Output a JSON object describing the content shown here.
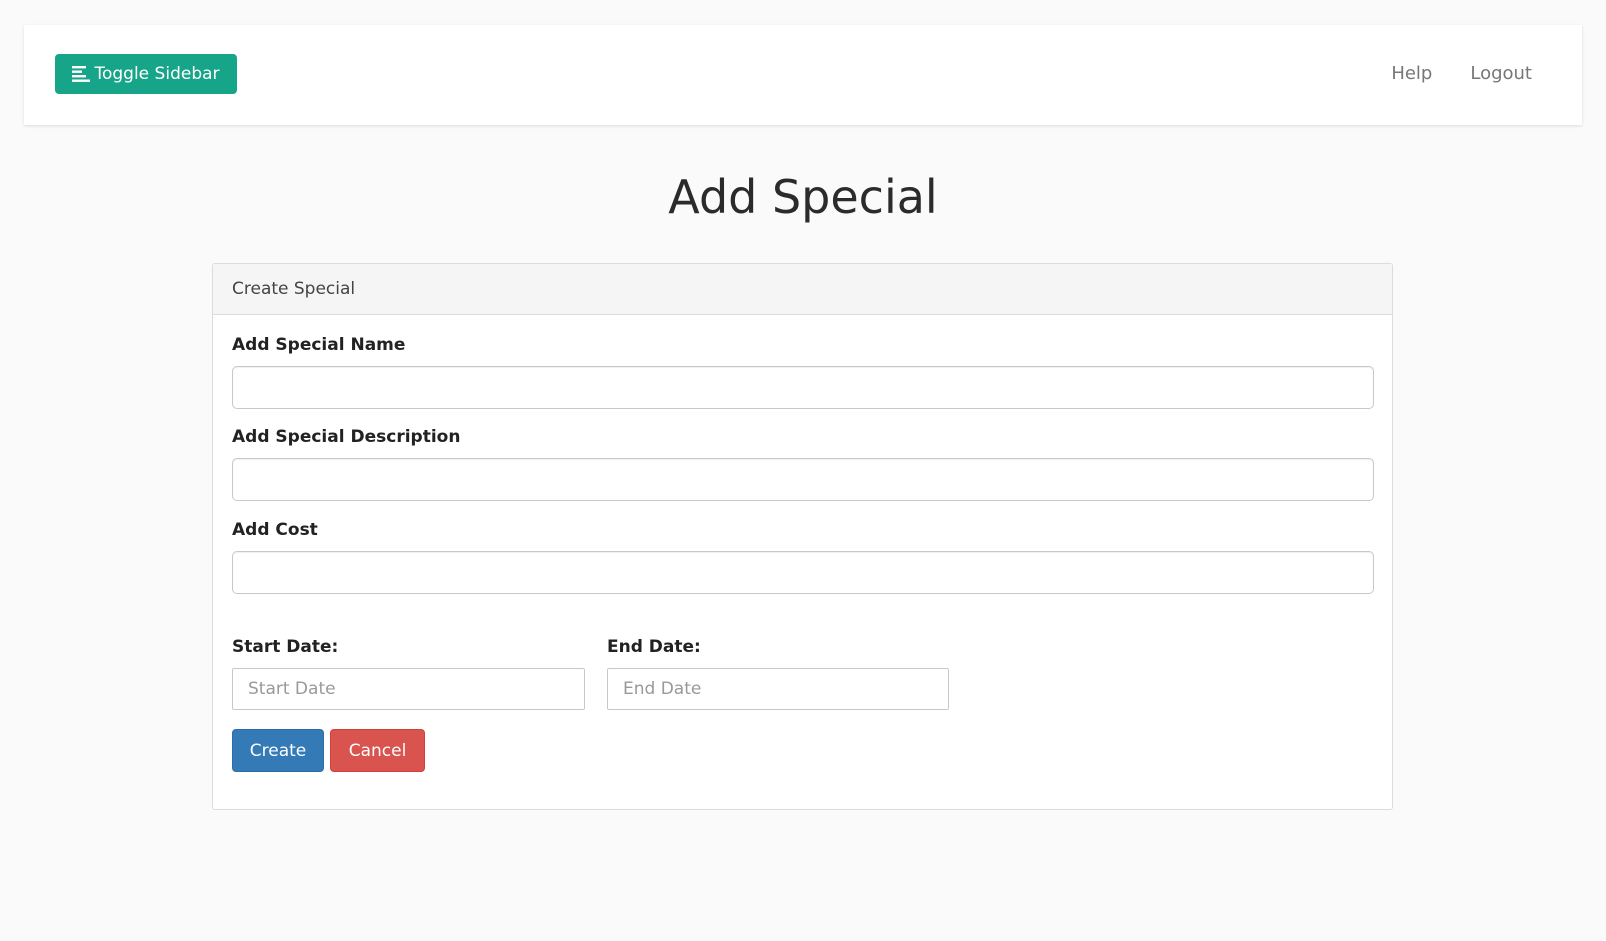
{
  "navbar": {
    "toggle_label": "Toggle Sidebar",
    "links": [
      "Help",
      "Logout"
    ]
  },
  "page": {
    "title": "Add Special"
  },
  "form": {
    "heading": "Create Special",
    "name_label": "Add Special Name",
    "name_value": "",
    "description_label": "Add Special Description",
    "description_value": "",
    "cost_label": "Add Cost",
    "cost_value": "",
    "start_date_label": "Start Date:",
    "start_date_placeholder": "Start Date",
    "end_date_label": "End Date:",
    "end_date_placeholder": "End Date",
    "create_label": "Create",
    "cancel_label": "Cancel"
  },
  "colors": {
    "toggle_bg": "#17a589",
    "create_bg": "#337ab7",
    "cancel_bg": "#d9534f"
  },
  "icons": {
    "toggle": "align-left-icon"
  }
}
